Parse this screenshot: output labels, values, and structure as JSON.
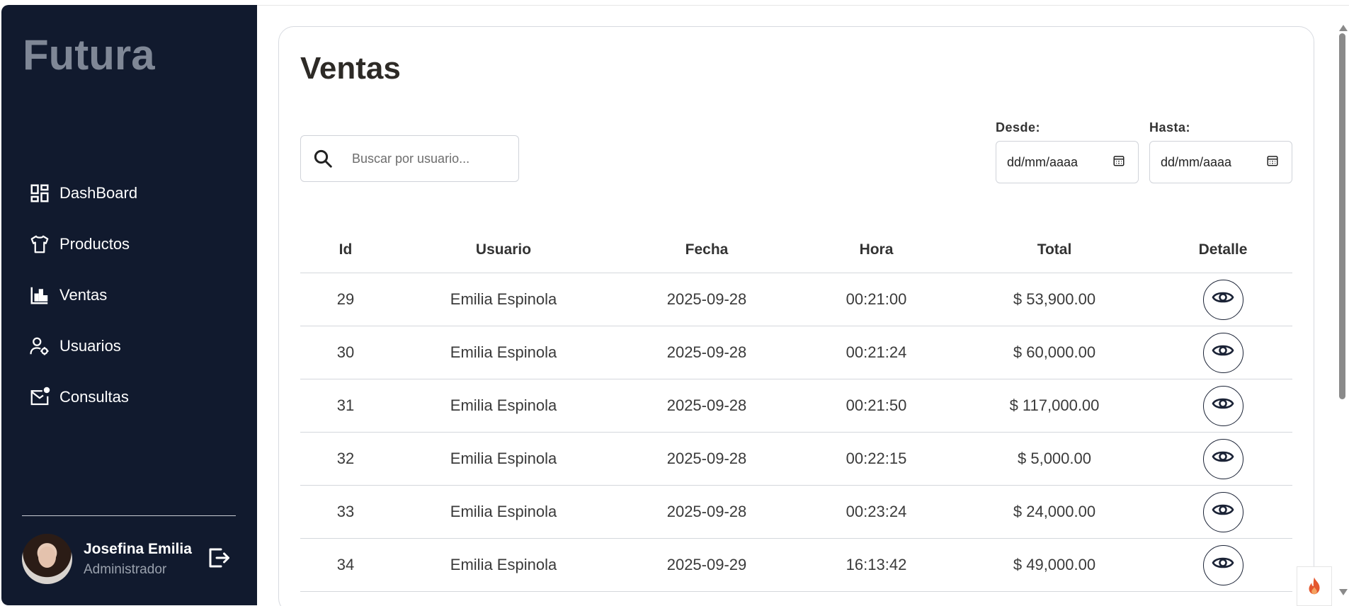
{
  "sidebar": {
    "brand": "Futura",
    "items": [
      {
        "label": "DashBoard",
        "icon": "dashboard-icon"
      },
      {
        "label": "Productos",
        "icon": "shirt-icon"
      },
      {
        "label": "Ventas",
        "icon": "bar-chart-icon"
      },
      {
        "label": "Usuarios",
        "icon": "user-settings-icon"
      },
      {
        "label": "Consultas",
        "icon": "mail-notification-icon"
      }
    ],
    "profile": {
      "name": "Josefina Emilia",
      "role": "Administrador"
    }
  },
  "main": {
    "title": "Ventas",
    "search": {
      "placeholder": "Buscar por usuario..."
    },
    "date_from": {
      "label": "Desde:",
      "value": "dd/mm/aaaa"
    },
    "date_to": {
      "label": "Hasta:",
      "value": "dd/mm/aaaa"
    },
    "table": {
      "columns": [
        "Id",
        "Usuario",
        "Fecha",
        "Hora",
        "Total",
        "Detalle"
      ],
      "rows": [
        {
          "id": "29",
          "user": "Emilia Espinola",
          "date": "2025-09-28",
          "hour": "00:21:00",
          "total": "$ 53,900.00"
        },
        {
          "id": "30",
          "user": "Emilia Espinola",
          "date": "2025-09-28",
          "hour": "00:21:24",
          "total": "$ 60,000.00"
        },
        {
          "id": "31",
          "user": "Emilia Espinola",
          "date": "2025-09-28",
          "hour": "00:21:50",
          "total": "$ 117,000.00"
        },
        {
          "id": "32",
          "user": "Emilia Espinola",
          "date": "2025-09-28",
          "hour": "00:22:15",
          "total": "$ 5,000.00"
        },
        {
          "id": "33",
          "user": "Emilia Espinola",
          "date": "2025-09-28",
          "hour": "00:23:24",
          "total": "$ 24,000.00"
        },
        {
          "id": "34",
          "user": "Emilia Espinola",
          "date": "2025-09-29",
          "hour": "16:13:42",
          "total": "$ 49,000.00"
        }
      ]
    }
  },
  "colors": {
    "sidebar_bg": "#111a2e",
    "brand_text": "#7f8796",
    "accent_flame": "#e4572e"
  }
}
